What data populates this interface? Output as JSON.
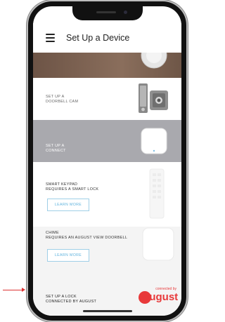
{
  "header": {
    "title": "Set Up a Device"
  },
  "rows": {
    "doorbell": {
      "line1": "SET UP A",
      "line2": "DOORBELL CAM"
    },
    "connect": {
      "line1": "SET UP A",
      "line2": "CONNECT"
    },
    "keypad": {
      "line1": "SMART KEYPAD",
      "line2": "REQUIRES A SMART LOCK",
      "button": "LEARN MORE"
    },
    "chime": {
      "line1": "CHIME",
      "line2": "REQUIRES AN AUGUST VIEW DOORBELL",
      "button": "LEARN MORE"
    },
    "lock": {
      "line1": "SET UP A LOCK",
      "line2": "CONNECTED BY AUGUST"
    }
  },
  "badge": {
    "top_text": "connected by",
    "brand": "august"
  },
  "colors": {
    "accent": "#5fb3dd",
    "brand_red": "#e8393a",
    "annotation_arrow": "#d33333"
  },
  "icons": [
    "menu-icon",
    "doorbell-cam-icon",
    "connect-bridge-icon",
    "keypad-icon",
    "chime-icon",
    "smart-lock-icon"
  ]
}
